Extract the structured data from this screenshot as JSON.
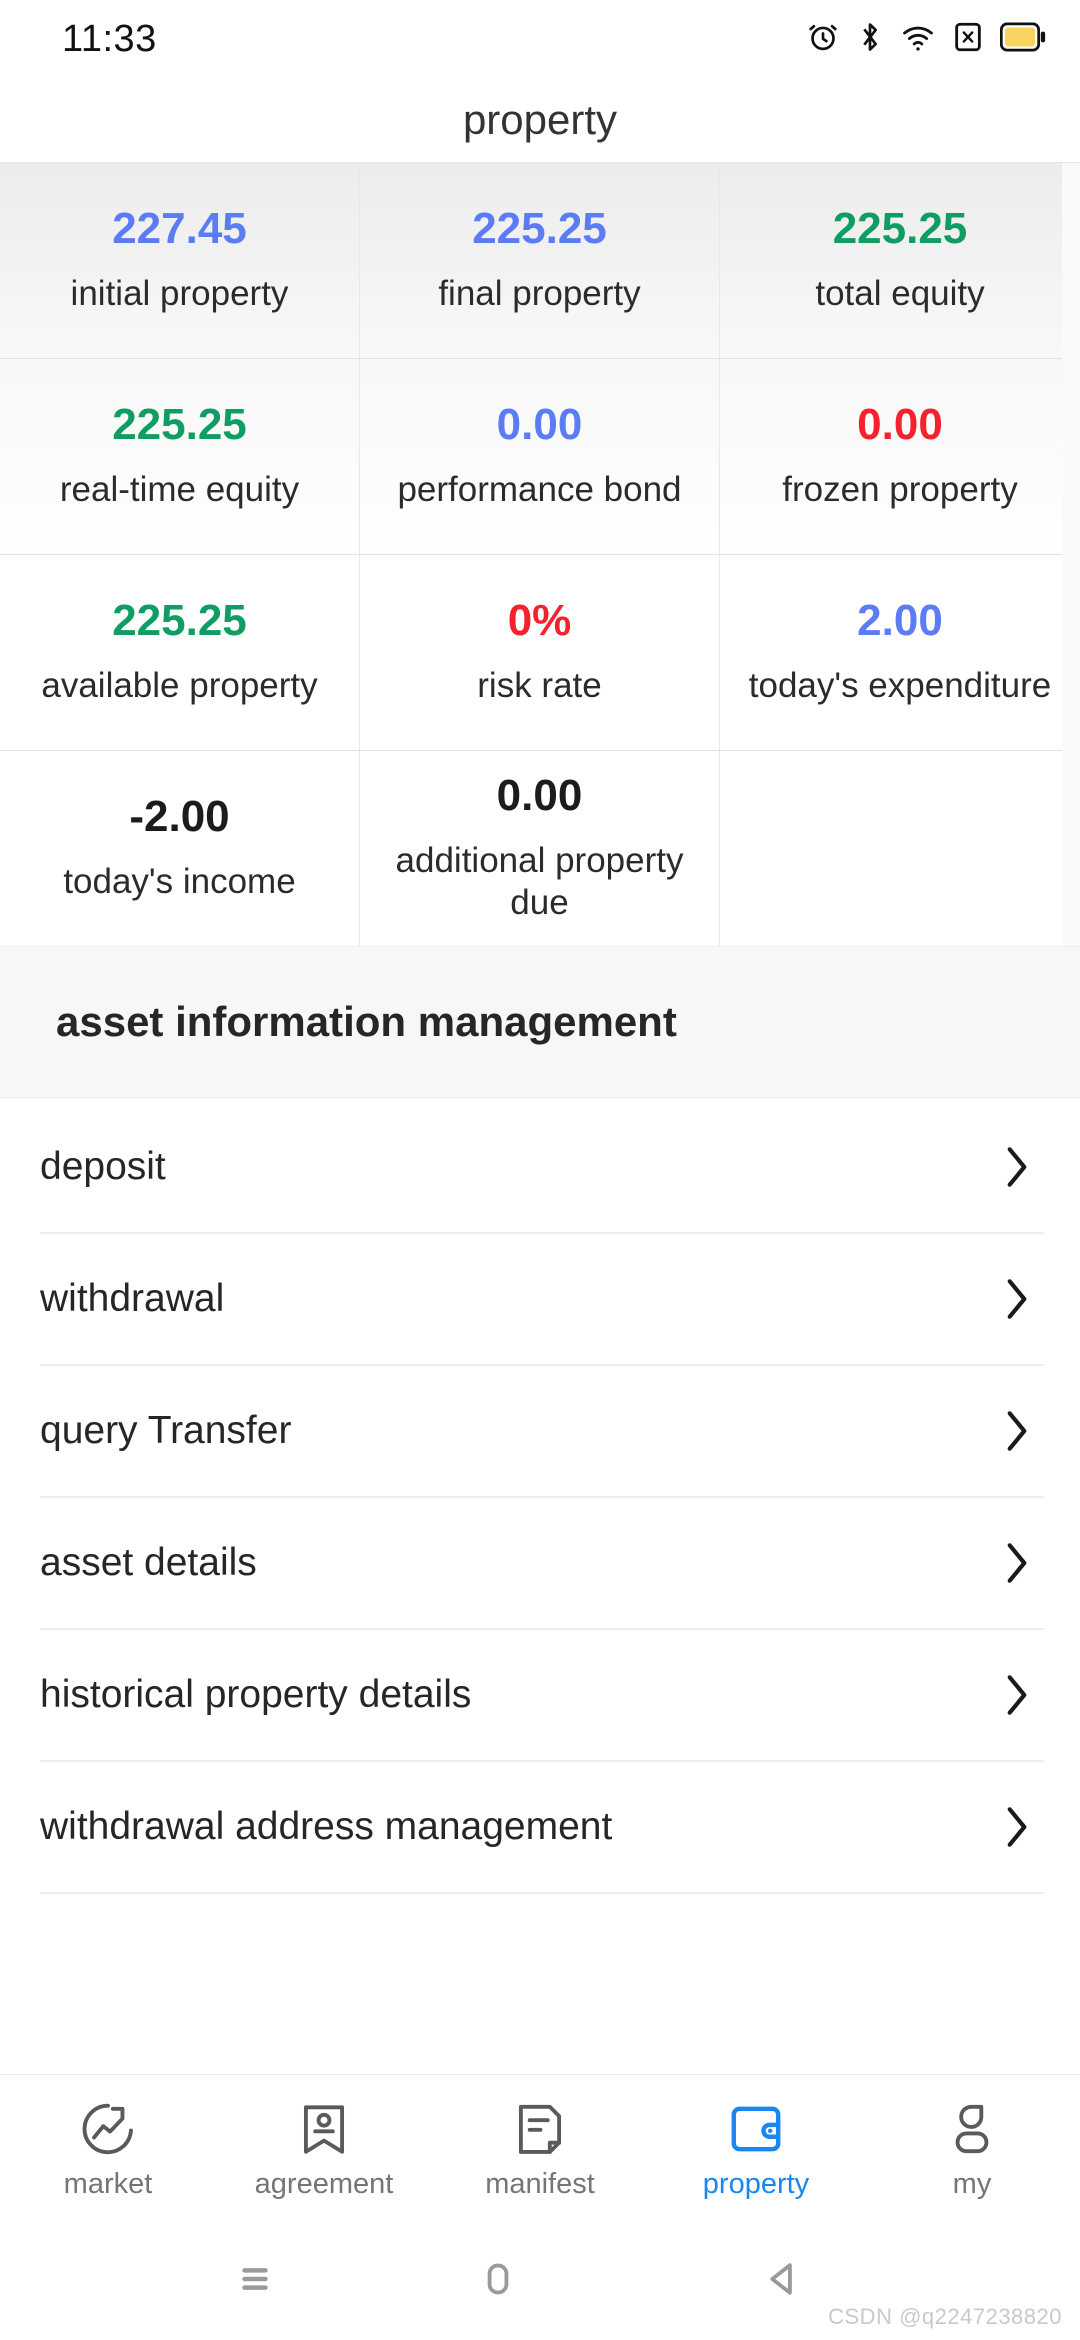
{
  "status_bar": {
    "time": "11:33",
    "icons": [
      "alarm-icon",
      "bluetooth-icon",
      "wifi-icon",
      "sim-disabled-icon",
      "battery-icon"
    ],
    "battery_color": "#F7D560"
  },
  "header": {
    "title": "property"
  },
  "stats": {
    "cells": [
      {
        "value": "227.45",
        "label": "initial property",
        "color_name": "blue",
        "color": "#5B7CF5"
      },
      {
        "value": "225.25",
        "label": "final property",
        "color_name": "blue",
        "color": "#5B7CF5"
      },
      {
        "value": "225.25",
        "label": "total equity",
        "color_name": "green",
        "color": "#0F9D63"
      },
      {
        "value": "225.25",
        "label": "real-time equity",
        "color_name": "green",
        "color": "#0F9D63"
      },
      {
        "value": "0.00",
        "label": "performance bond",
        "color_name": "blue",
        "color": "#5B7CF5"
      },
      {
        "value": "0.00",
        "label": "frozen property",
        "color_name": "red",
        "color": "#F5222D"
      },
      {
        "value": "225.25",
        "label": "available property",
        "color_name": "green",
        "color": "#0F9D63"
      },
      {
        "value": "0%",
        "label": "risk rate",
        "color_name": "red",
        "color": "#F5222D"
      },
      {
        "value": "2.00",
        "label": "today's expenditure",
        "color_name": "blue",
        "color": "#5B7CF5"
      },
      {
        "value": "-2.00",
        "label": "today's income",
        "color_name": "dark",
        "color": "#1C1C1C"
      },
      {
        "value": "0.00",
        "label": "additional property due",
        "color_name": "dark",
        "color": "#1C1C1C"
      },
      {
        "value": "",
        "label": "",
        "color_name": "dark",
        "color": "#1C1C1C"
      }
    ]
  },
  "section": {
    "title": "asset information management"
  },
  "menu": {
    "items": [
      {
        "label": "deposit"
      },
      {
        "label": "withdrawal"
      },
      {
        "label": "query Transfer"
      },
      {
        "label": "asset details"
      },
      {
        "label": "historical property details"
      },
      {
        "label": "withdrawal address management"
      }
    ],
    "chevron_icon": "chevron-right-icon"
  },
  "tabbar": {
    "active_color": "#1B86F0",
    "inactive_color": "#757575",
    "tabs": [
      {
        "label": "market",
        "icon": "market-trend-icon",
        "active": false
      },
      {
        "label": "agreement",
        "icon": "bookmark-user-icon",
        "active": false
      },
      {
        "label": "manifest",
        "icon": "document-list-icon",
        "active": false
      },
      {
        "label": "property",
        "icon": "wallet-icon",
        "active": true
      },
      {
        "label": "my",
        "icon": "person-icon",
        "active": false
      }
    ]
  },
  "navbar": {
    "buttons": [
      {
        "name": "recents-icon"
      },
      {
        "name": "home-icon"
      },
      {
        "name": "back-icon"
      }
    ]
  },
  "watermark": {
    "text": "CSDN @q2247238820"
  }
}
